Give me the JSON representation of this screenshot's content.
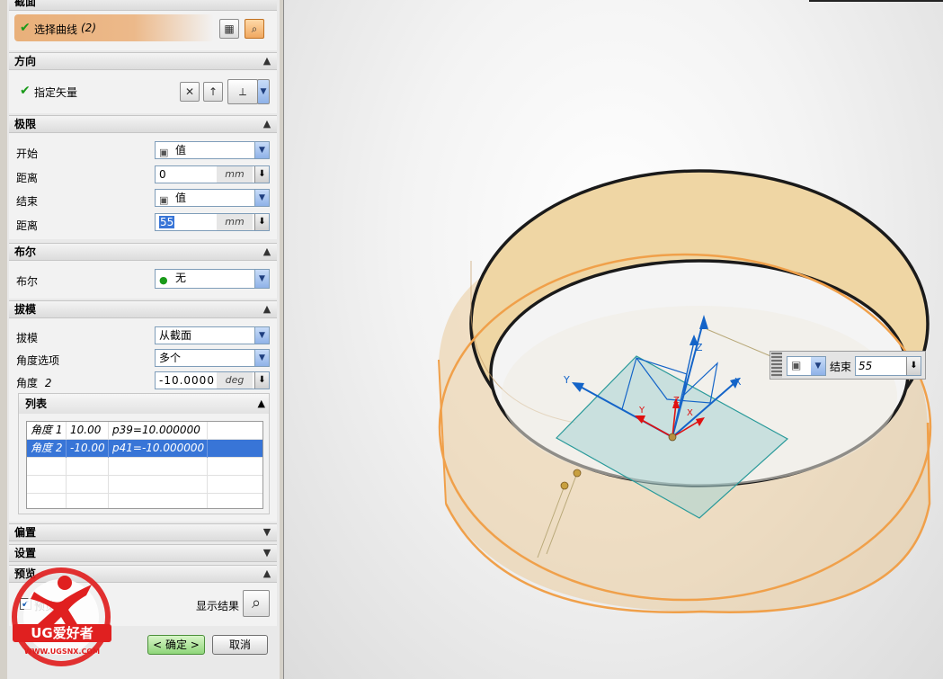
{
  "dialog": {
    "section_section": {
      "title": "截面",
      "select_curve_label": "选择曲线",
      "select_curve_count": "(2)"
    },
    "section_direction": {
      "title": "方向",
      "vector_label": "指定矢量"
    },
    "section_limits": {
      "title": "极限",
      "start_label": "开始",
      "start_value": "值",
      "start_distance_label": "距离",
      "start_distance_value": "0",
      "start_distance_unit": "mm",
      "end_label": "结束",
      "end_value": "值",
      "end_distance_label": "距离",
      "end_distance_value": "55",
      "end_distance_unit": "mm"
    },
    "section_boolean": {
      "title": "布尔",
      "boolean_label": "布尔",
      "boolean_value": "无"
    },
    "section_draft": {
      "title": "拔模",
      "draft_label": "拔模",
      "draft_value": "从截面",
      "angle_option_label": "角度选项",
      "angle_option_value": "多个",
      "angle_label": "角度",
      "angle_index": "2",
      "angle_value": "-10.0000",
      "angle_unit": "deg",
      "list": {
        "title": "列表",
        "rows": [
          {
            "name": "角度",
            "index": "1",
            "value": "10.00",
            "expr": "p39=10.000000"
          },
          {
            "name": "角度",
            "index": "2",
            "value": "-10.00",
            "expr": "p41=-10.000000"
          }
        ]
      }
    },
    "section_offset": {
      "title": "偏置"
    },
    "section_settings": {
      "title": "设置"
    },
    "section_preview": {
      "title": "预览",
      "preview_label": "预览",
      "show_result_label": "显示结果"
    },
    "ok_label": "< 确定 >",
    "cancel_label": "取消",
    "logo_text": "UG爱好者",
    "logo_url": "WWW.UGSNX.COM"
  },
  "viewport": {
    "float_end_label": "结束",
    "float_end_value": "55",
    "axis_labels": {
      "z": "Z",
      "y": "Y",
      "x": "X",
      "z_small": "Z",
      "y_small": "Y",
      "x_small": "X"
    }
  },
  "colors": {
    "orange_highlight": "#f0a04a",
    "ring_fill": "#efd6a4",
    "plane_fill": "#a8d4d4",
    "axis_blue": "#1464c8",
    "axis_red": "#e01010"
  }
}
